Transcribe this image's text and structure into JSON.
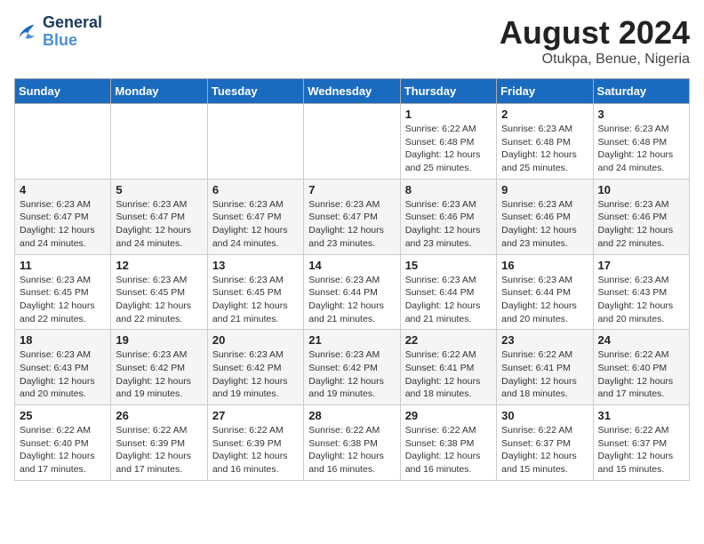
{
  "header": {
    "logo_line1": "General",
    "logo_line2": "Blue",
    "month_title": "August 2024",
    "location": "Otukpa, Benue, Nigeria"
  },
  "weekdays": [
    "Sunday",
    "Monday",
    "Tuesday",
    "Wednesday",
    "Thursday",
    "Friday",
    "Saturday"
  ],
  "weeks": [
    [
      {
        "day": "",
        "info": ""
      },
      {
        "day": "",
        "info": ""
      },
      {
        "day": "",
        "info": ""
      },
      {
        "day": "",
        "info": ""
      },
      {
        "day": "1",
        "info": "Sunrise: 6:22 AM\nSunset: 6:48 PM\nDaylight: 12 hours\nand 25 minutes."
      },
      {
        "day": "2",
        "info": "Sunrise: 6:23 AM\nSunset: 6:48 PM\nDaylight: 12 hours\nand 25 minutes."
      },
      {
        "day": "3",
        "info": "Sunrise: 6:23 AM\nSunset: 6:48 PM\nDaylight: 12 hours\nand 24 minutes."
      }
    ],
    [
      {
        "day": "4",
        "info": "Sunrise: 6:23 AM\nSunset: 6:47 PM\nDaylight: 12 hours\nand 24 minutes."
      },
      {
        "day": "5",
        "info": "Sunrise: 6:23 AM\nSunset: 6:47 PM\nDaylight: 12 hours\nand 24 minutes."
      },
      {
        "day": "6",
        "info": "Sunrise: 6:23 AM\nSunset: 6:47 PM\nDaylight: 12 hours\nand 24 minutes."
      },
      {
        "day": "7",
        "info": "Sunrise: 6:23 AM\nSunset: 6:47 PM\nDaylight: 12 hours\nand 23 minutes."
      },
      {
        "day": "8",
        "info": "Sunrise: 6:23 AM\nSunset: 6:46 PM\nDaylight: 12 hours\nand 23 minutes."
      },
      {
        "day": "9",
        "info": "Sunrise: 6:23 AM\nSunset: 6:46 PM\nDaylight: 12 hours\nand 23 minutes."
      },
      {
        "day": "10",
        "info": "Sunrise: 6:23 AM\nSunset: 6:46 PM\nDaylight: 12 hours\nand 22 minutes."
      }
    ],
    [
      {
        "day": "11",
        "info": "Sunrise: 6:23 AM\nSunset: 6:45 PM\nDaylight: 12 hours\nand 22 minutes."
      },
      {
        "day": "12",
        "info": "Sunrise: 6:23 AM\nSunset: 6:45 PM\nDaylight: 12 hours\nand 22 minutes."
      },
      {
        "day": "13",
        "info": "Sunrise: 6:23 AM\nSunset: 6:45 PM\nDaylight: 12 hours\nand 21 minutes."
      },
      {
        "day": "14",
        "info": "Sunrise: 6:23 AM\nSunset: 6:44 PM\nDaylight: 12 hours\nand 21 minutes."
      },
      {
        "day": "15",
        "info": "Sunrise: 6:23 AM\nSunset: 6:44 PM\nDaylight: 12 hours\nand 21 minutes."
      },
      {
        "day": "16",
        "info": "Sunrise: 6:23 AM\nSunset: 6:44 PM\nDaylight: 12 hours\nand 20 minutes."
      },
      {
        "day": "17",
        "info": "Sunrise: 6:23 AM\nSunset: 6:43 PM\nDaylight: 12 hours\nand 20 minutes."
      }
    ],
    [
      {
        "day": "18",
        "info": "Sunrise: 6:23 AM\nSunset: 6:43 PM\nDaylight: 12 hours\nand 20 minutes."
      },
      {
        "day": "19",
        "info": "Sunrise: 6:23 AM\nSunset: 6:42 PM\nDaylight: 12 hours\nand 19 minutes."
      },
      {
        "day": "20",
        "info": "Sunrise: 6:23 AM\nSunset: 6:42 PM\nDaylight: 12 hours\nand 19 minutes."
      },
      {
        "day": "21",
        "info": "Sunrise: 6:23 AM\nSunset: 6:42 PM\nDaylight: 12 hours\nand 19 minutes."
      },
      {
        "day": "22",
        "info": "Sunrise: 6:22 AM\nSunset: 6:41 PM\nDaylight: 12 hours\nand 18 minutes."
      },
      {
        "day": "23",
        "info": "Sunrise: 6:22 AM\nSunset: 6:41 PM\nDaylight: 12 hours\nand 18 minutes."
      },
      {
        "day": "24",
        "info": "Sunrise: 6:22 AM\nSunset: 6:40 PM\nDaylight: 12 hours\nand 17 minutes."
      }
    ],
    [
      {
        "day": "25",
        "info": "Sunrise: 6:22 AM\nSunset: 6:40 PM\nDaylight: 12 hours\nand 17 minutes."
      },
      {
        "day": "26",
        "info": "Sunrise: 6:22 AM\nSunset: 6:39 PM\nDaylight: 12 hours\nand 17 minutes."
      },
      {
        "day": "27",
        "info": "Sunrise: 6:22 AM\nSunset: 6:39 PM\nDaylight: 12 hours\nand 16 minutes."
      },
      {
        "day": "28",
        "info": "Sunrise: 6:22 AM\nSunset: 6:38 PM\nDaylight: 12 hours\nand 16 minutes."
      },
      {
        "day": "29",
        "info": "Sunrise: 6:22 AM\nSunset: 6:38 PM\nDaylight: 12 hours\nand 16 minutes."
      },
      {
        "day": "30",
        "info": "Sunrise: 6:22 AM\nSunset: 6:37 PM\nDaylight: 12 hours\nand 15 minutes."
      },
      {
        "day": "31",
        "info": "Sunrise: 6:22 AM\nSunset: 6:37 PM\nDaylight: 12 hours\nand 15 minutes."
      }
    ]
  ]
}
